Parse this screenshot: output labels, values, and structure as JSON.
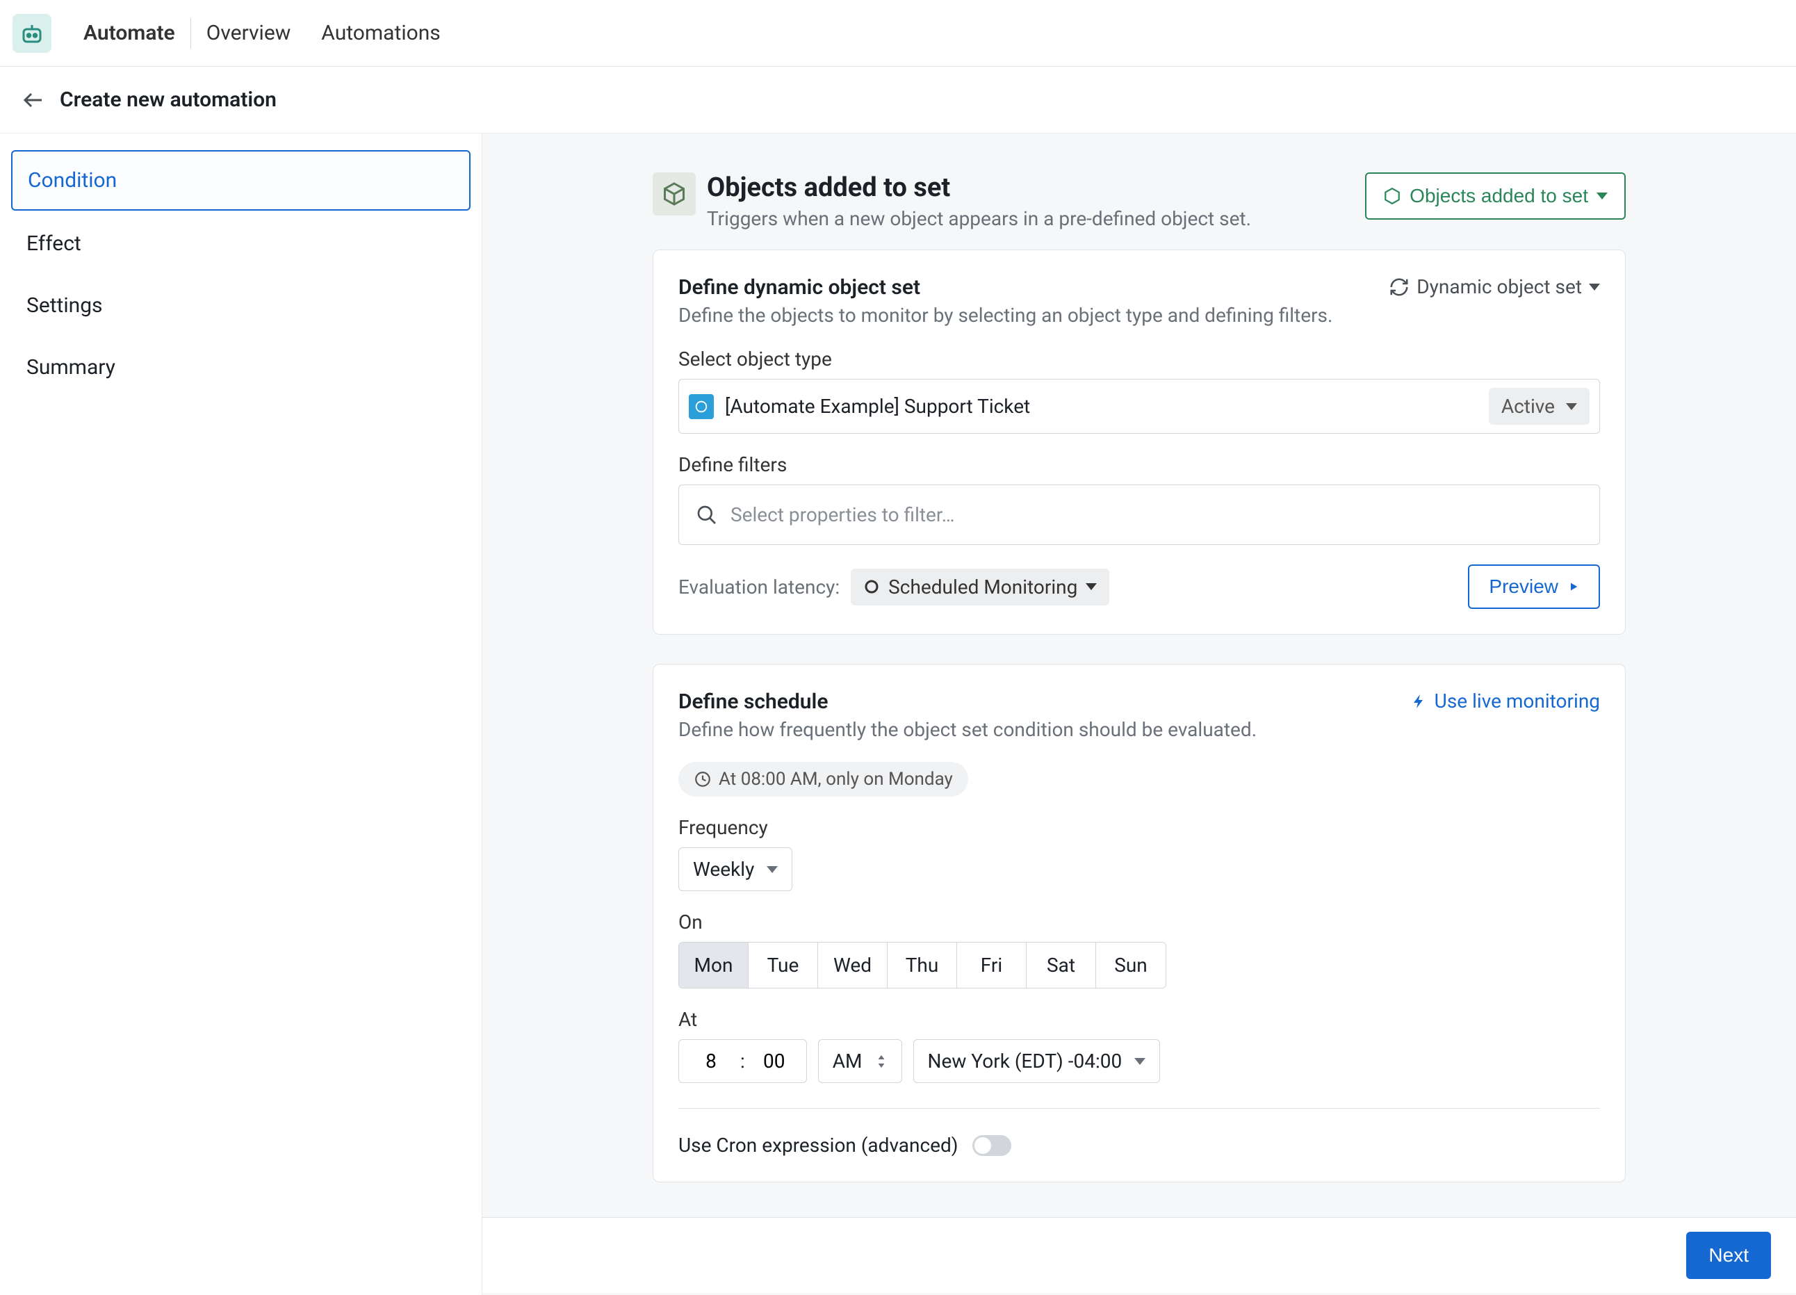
{
  "top": {
    "app_label": "Automate",
    "links": [
      "Overview",
      "Automations"
    ]
  },
  "subheader": {
    "title": "Create new automation"
  },
  "sidebar": {
    "items": [
      {
        "label": "Condition",
        "active": true
      },
      {
        "label": "Effect",
        "active": false
      },
      {
        "label": "Settings",
        "active": false
      },
      {
        "label": "Summary",
        "active": false
      }
    ]
  },
  "header": {
    "title": "Objects added to set",
    "subtitle": "Triggers when a new object appears in a pre-defined object set.",
    "trigger_button": "Objects added to set"
  },
  "object_set_card": {
    "title": "Define dynamic object set",
    "side_button": "Dynamic object set",
    "desc": "Define the objects to monitor by selecting an object type and defining filters.",
    "object_type_label": "Select object type",
    "object_type_value": "[Automate Example] Support Ticket",
    "object_status": "Active",
    "filters_label": "Define filters",
    "filters_placeholder": "Select properties to filter…",
    "latency_label": "Evaluation latency:",
    "latency_value": "Scheduled Monitoring",
    "preview_button": "Preview"
  },
  "schedule_card": {
    "title": "Define schedule",
    "live_link": "Use live monitoring",
    "desc": "Define how frequently the object set condition should be evaluated.",
    "summary_chip": "At 08:00 AM, only on Monday",
    "frequency_label": "Frequency",
    "frequency_value": "Weekly",
    "on_label": "On",
    "days": [
      "Mon",
      "Tue",
      "Wed",
      "Thu",
      "Fri",
      "Sat",
      "Sun"
    ],
    "selected_day_index": 0,
    "at_label": "At",
    "hour": "8",
    "minute": "00",
    "ampm": "AM",
    "timezone": "New York (EDT) -04:00",
    "cron_label": "Use Cron expression (advanced)"
  },
  "footer": {
    "next": "Next"
  }
}
